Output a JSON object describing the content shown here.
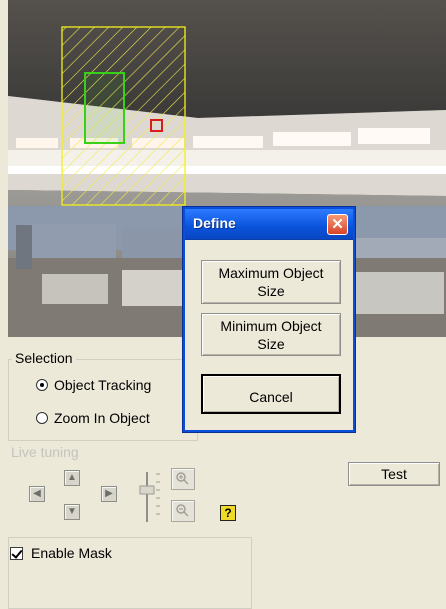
{
  "app": {
    "colors": {
      "background": "#ECE9D8",
      "window_blue": "#0A52DB",
      "close_red": "#D9442A",
      "selection_yellow": "#F3F01A",
      "selection_green": "#38D018",
      "selection_red": "#D61E1E"
    }
  },
  "selection": {
    "title": "Selection",
    "options": [
      {
        "label": "Object Tracking",
        "selected": true
      },
      {
        "label": "Zoom In Object",
        "selected": false
      }
    ]
  },
  "live_tuning": {
    "title": "Live tuning",
    "icons": [
      "arrow-left-icon",
      "arrow-up-icon",
      "arrow-down-icon",
      "arrow-right-icon",
      "slider-icon",
      "zoom-in-icon",
      "zoom-out-icon",
      "help-icon"
    ],
    "help_label": "?"
  },
  "actions": {
    "test_label": "Test"
  },
  "mask": {
    "label": "Enable Mask",
    "checked": true
  },
  "dialog": {
    "title": "Define",
    "close_label": "✕",
    "buttons": {
      "max": "Maximum Object\nSize",
      "min": "Minimum Object\nSize",
      "cancel": "Cancel"
    }
  }
}
